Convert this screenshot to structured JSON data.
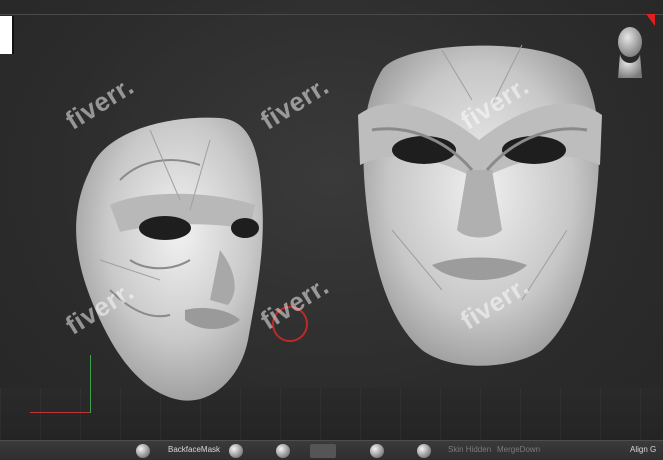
{
  "watermark_text": "fiverr.",
  "toolbar": {
    "backface_mask": "BackfaceMask",
    "skin_hidden": "Skin Hidden",
    "merge_down": "MergeDown",
    "align_label": "Align G"
  },
  "colors": {
    "viewport_bg": "#2c2c2c",
    "axis_y": "#3aa34a",
    "axis_x": "#c03535",
    "gizmo": "#c02828",
    "indicator": "#e02020"
  },
  "icons": {
    "head_navigation": "head-icon",
    "brush_spheres": "sphere-icon"
  }
}
